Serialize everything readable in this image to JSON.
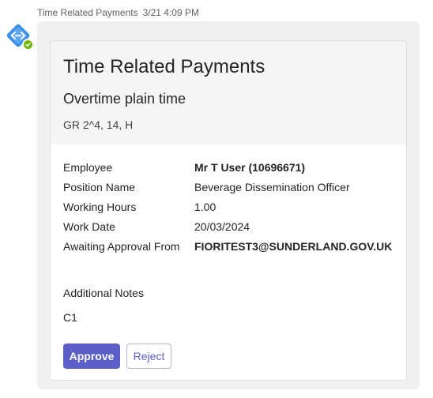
{
  "message": {
    "sender": "Time Related Payments",
    "timestamp": "3/21 4:09 PM",
    "avatar_icon": "code-diamond-icon",
    "presence_status": "available",
    "presence_color": "#6bb700"
  },
  "card": {
    "title": "Time Related Payments",
    "subtitle": "Overtime plain time",
    "grade": "GR 2^4, 14, H",
    "facts": [
      {
        "label": "Employee",
        "value": "Mr T User (10696671)",
        "bold": true
      },
      {
        "label": "Position Name",
        "value": "Beverage Dissemination Officer",
        "bold": false
      },
      {
        "label": "Working Hours",
        "value": "1.00",
        "bold": false
      },
      {
        "label": "Work Date",
        "value": "20/03/2024",
        "bold": false
      },
      {
        "label": "Awaiting Approval From",
        "value": "FIORITEST3@SUNDERLAND.GOV.UK",
        "bold": true
      }
    ],
    "notes_label": "Additional Notes",
    "notes_value": "C1",
    "actions": {
      "approve_label": "Approve",
      "reject_label": "Reject"
    },
    "accent_color": "#5b5fc7"
  }
}
